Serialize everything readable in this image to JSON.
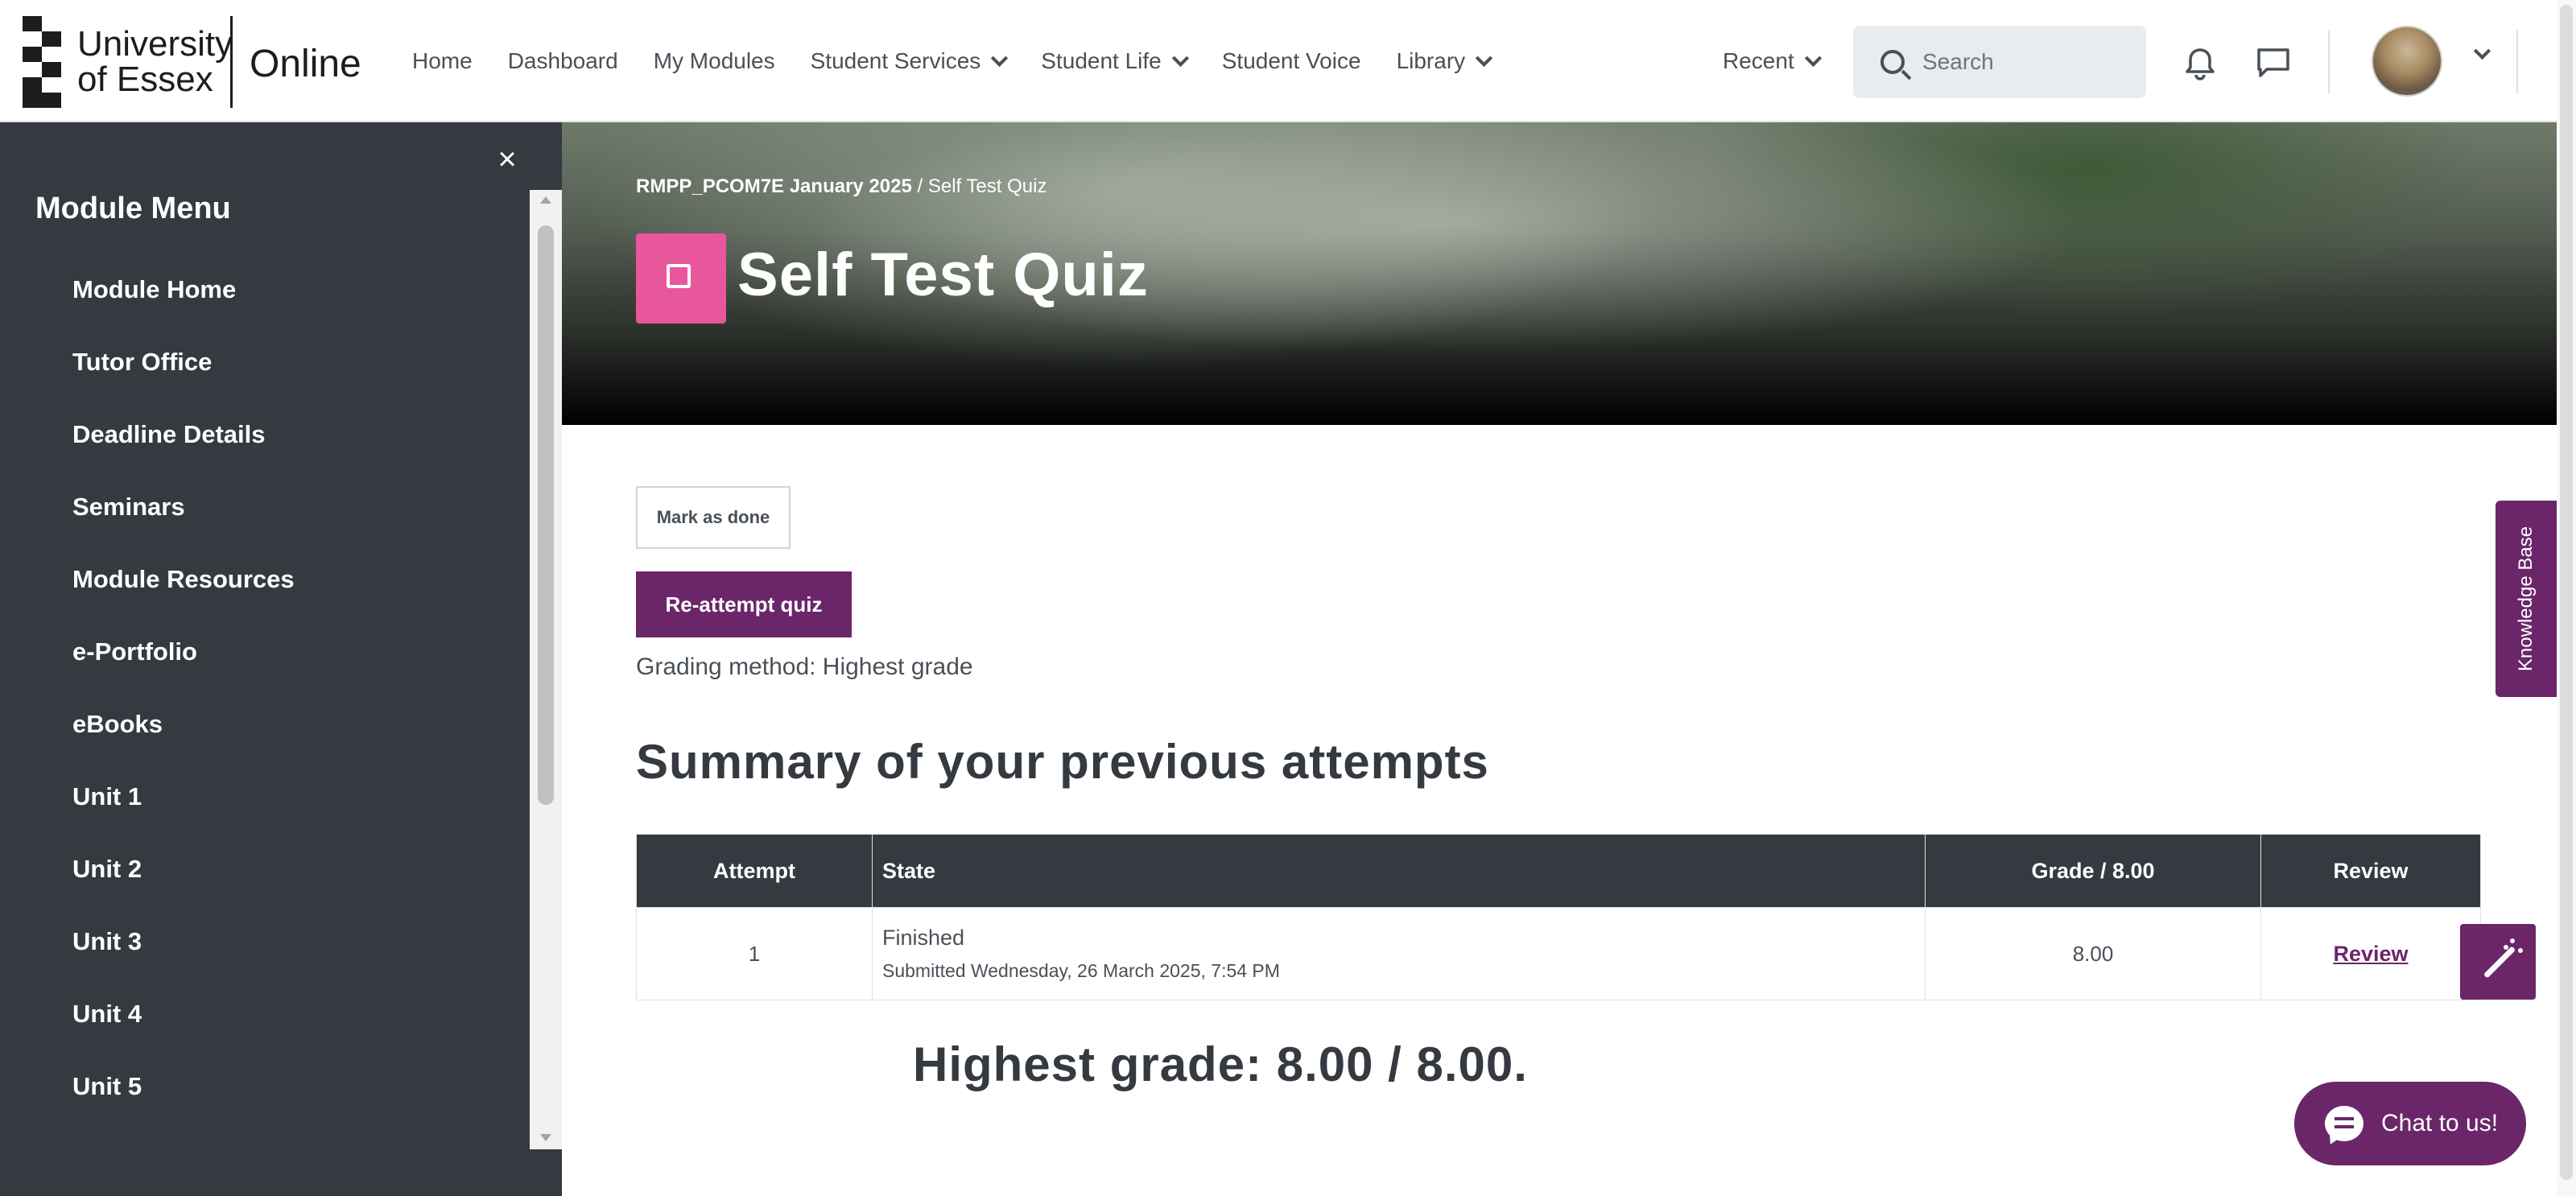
{
  "brand": {
    "logo_line1": "University",
    "logo_line2": "of Essex",
    "product": "Online"
  },
  "nav": {
    "links": [
      {
        "label": "Home"
      },
      {
        "label": "Dashboard"
      },
      {
        "label": "My Modules"
      },
      {
        "label": "Student Services",
        "dropdown": true
      },
      {
        "label": "Student Life",
        "dropdown": true
      },
      {
        "label": "Student Voice"
      },
      {
        "label": "Library",
        "dropdown": true
      }
    ],
    "recent_label": "Recent",
    "search_placeholder": "Search",
    "icons": [
      "bell-icon",
      "chat-icon",
      "avatar",
      "chevron-down-icon"
    ]
  },
  "drawer": {
    "close_glyph": "×",
    "title": "Module Menu",
    "items": [
      {
        "label": "Module Home"
      },
      {
        "label": "Tutor Office"
      },
      {
        "label": "Deadline Details"
      },
      {
        "label": "Seminars"
      },
      {
        "label": "Module Resources"
      },
      {
        "label": "e-Portfolio"
      },
      {
        "label": "eBooks"
      },
      {
        "label": "Unit 1"
      },
      {
        "label": "Unit 2"
      },
      {
        "label": "Unit 3"
      },
      {
        "label": "Unit 4"
      },
      {
        "label": "Unit 5"
      }
    ]
  },
  "header": {
    "breadcrumb_module": "RMPP_PCOM7E January 2025",
    "breadcrumb_separator": "/",
    "breadcrumb_current": "Self Test Quiz",
    "title": "Self Test Quiz",
    "icon_color": "#e8579b"
  },
  "main": {
    "mark_done_label": "Mark as done",
    "reattempt_label": "Re-attempt quiz",
    "grading_method": "Grading method: Highest grade",
    "summary_title": "Summary of your previous attempts",
    "table": {
      "headers": [
        "Attempt",
        "State",
        "Grade / 8.00",
        "Review"
      ],
      "rows": [
        {
          "attempt": "1",
          "state": "Finished",
          "submitted": "Submitted Wednesday, 26 March 2025, 7:54 PM",
          "grade": "8.00",
          "review": "Review"
        }
      ]
    },
    "highest_grade": "Highest grade: 8.00 / 8.00."
  },
  "widgets": {
    "knowledge_base": "Knowledge Base",
    "chat_label": "Chat to us!",
    "accent_color": "#6a2669"
  }
}
